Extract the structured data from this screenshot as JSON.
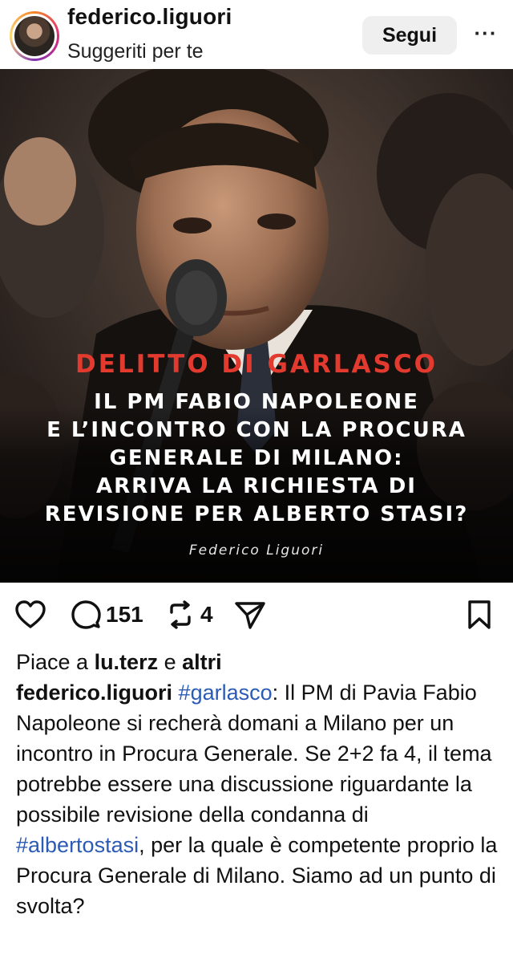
{
  "header": {
    "username": "federico.liguori",
    "subtitle": "Suggeriti per te",
    "follow_label": "Segui",
    "more_label": "···"
  },
  "post": {
    "image": {
      "headline_red": "DELITTO DI GARLASCO",
      "headline_lines": [
        "IL PM FABIO NAPOLEONE",
        "E L’INCONTRO CON LA PROCURA",
        "GENERALE DI MILANO:",
        "ARRIVA LA RICHIESTA DI",
        "REVISIONE PER ALBERTO STASI?"
      ],
      "credit": "Federico Liguori"
    },
    "actions": {
      "like_icon": "heart-icon",
      "comment_icon": "comment-icon",
      "comment_count": "151",
      "repost_icon": "repost-icon",
      "repost_count": "4",
      "share_icon": "send-icon",
      "save_icon": "bookmark-icon"
    },
    "likes": {
      "prefix": "Piace a ",
      "user": "lu.terz",
      "middle": " e ",
      "others": "altri"
    },
    "caption": {
      "username": "federico.liguori",
      "hashtag1": "#garlasco",
      "text1": ": Il PM di Pavia Fabio Napoleone si recherà domani a Milano per un incontro in Procura Generale. Se 2+2 fa 4, il tema potrebbe essere una discussione riguardante la possibile revisione della condanna di ",
      "hashtag2": "#albertostasi",
      "text2": ", per la quale è competente proprio la Procura Generale di Milano. Siamo ad un punto di svolta?"
    }
  },
  "colors": {
    "headline_red": "#e23a2e",
    "hashtag_blue": "#2b5bb5",
    "follow_bg": "#efefef"
  }
}
